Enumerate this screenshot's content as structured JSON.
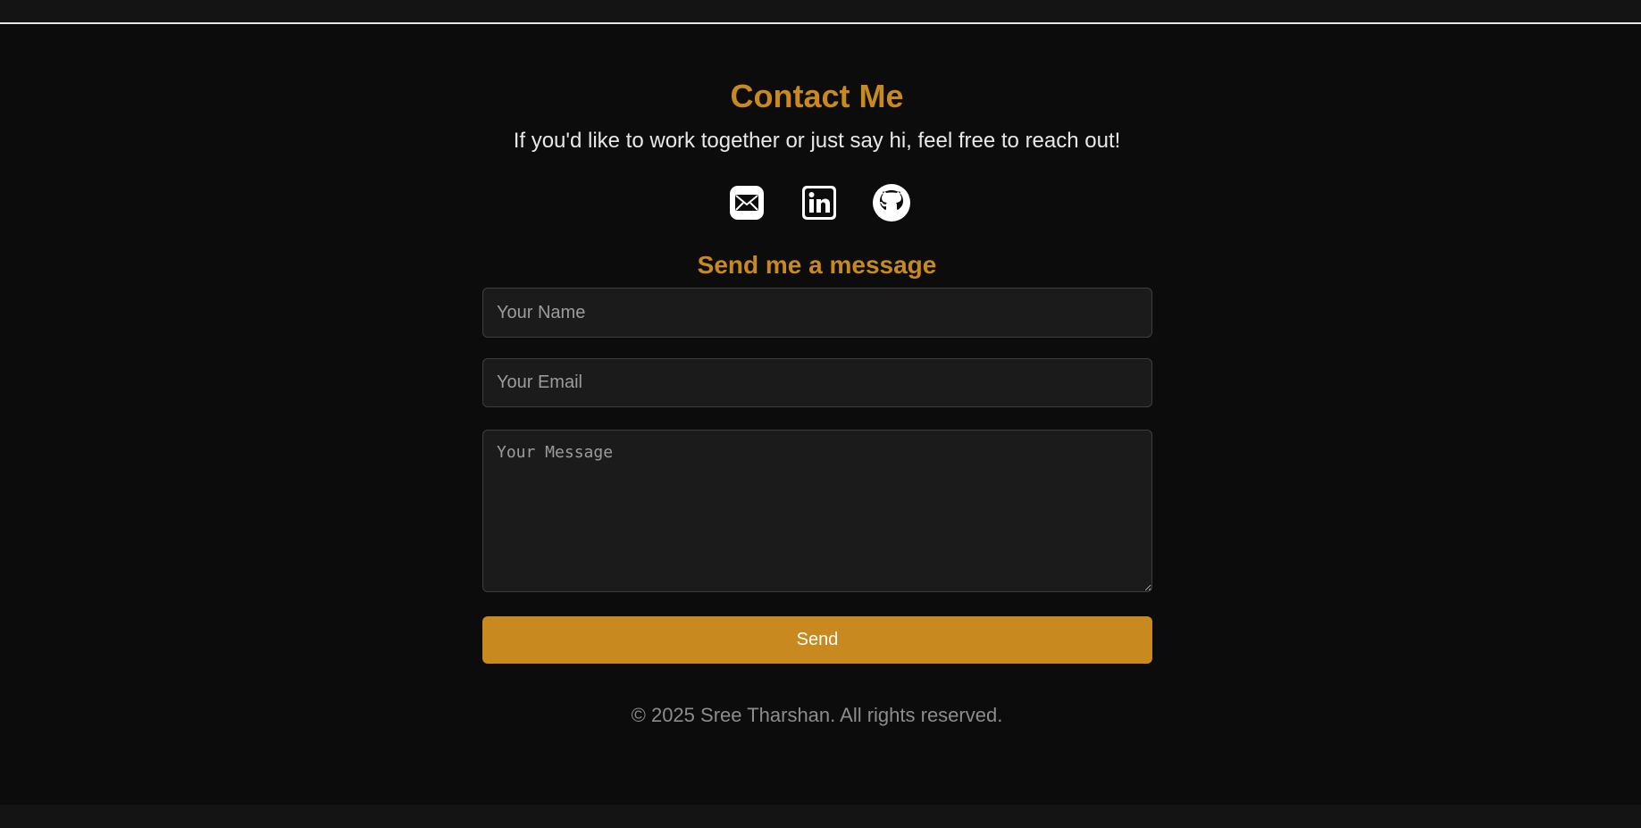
{
  "contact": {
    "title": "Contact Me",
    "subtitle": "If you'd like to work together or just say hi, feel free to reach out!",
    "socials": [
      {
        "icon": "email-icon"
      },
      {
        "icon": "linkedin-icon"
      },
      {
        "icon": "github-icon"
      }
    ]
  },
  "form": {
    "title": "Send me a message",
    "name_placeholder": "Your Name",
    "email_placeholder": "Your Email",
    "message_placeholder": "Your Message",
    "send_label": "Send"
  },
  "footer": {
    "text": "© 2025 Sree Tharshan. All rights reserved."
  },
  "colors": {
    "accent": "#c8891e",
    "background": "#0c0c0c",
    "field_background": "#1b1b1b"
  }
}
